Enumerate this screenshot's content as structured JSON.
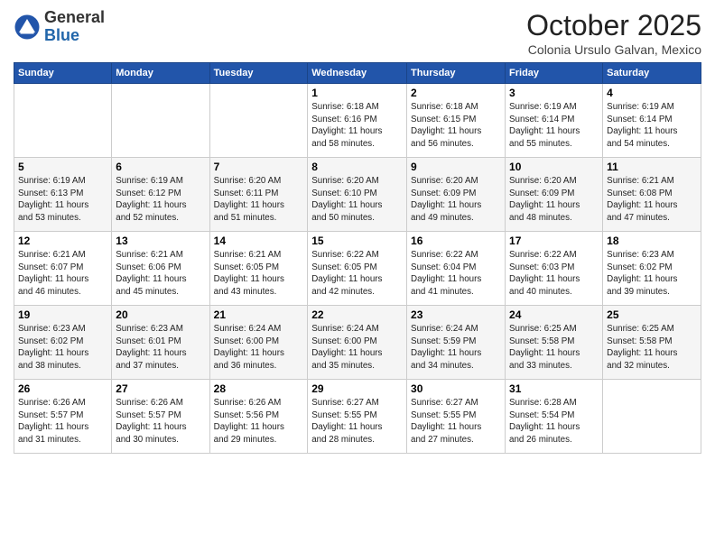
{
  "logo": {
    "general": "General",
    "blue": "Blue"
  },
  "title": "October 2025",
  "location": "Colonia Ursulo Galvan, Mexico",
  "days_of_week": [
    "Sunday",
    "Monday",
    "Tuesday",
    "Wednesday",
    "Thursday",
    "Friday",
    "Saturday"
  ],
  "weeks": [
    [
      {
        "day": "",
        "info": ""
      },
      {
        "day": "",
        "info": ""
      },
      {
        "day": "",
        "info": ""
      },
      {
        "day": "1",
        "info": "Sunrise: 6:18 AM\nSunset: 6:16 PM\nDaylight: 11 hours\nand 58 minutes."
      },
      {
        "day": "2",
        "info": "Sunrise: 6:18 AM\nSunset: 6:15 PM\nDaylight: 11 hours\nand 56 minutes."
      },
      {
        "day": "3",
        "info": "Sunrise: 6:19 AM\nSunset: 6:14 PM\nDaylight: 11 hours\nand 55 minutes."
      },
      {
        "day": "4",
        "info": "Sunrise: 6:19 AM\nSunset: 6:14 PM\nDaylight: 11 hours\nand 54 minutes."
      }
    ],
    [
      {
        "day": "5",
        "info": "Sunrise: 6:19 AM\nSunset: 6:13 PM\nDaylight: 11 hours\nand 53 minutes."
      },
      {
        "day": "6",
        "info": "Sunrise: 6:19 AM\nSunset: 6:12 PM\nDaylight: 11 hours\nand 52 minutes."
      },
      {
        "day": "7",
        "info": "Sunrise: 6:20 AM\nSunset: 6:11 PM\nDaylight: 11 hours\nand 51 minutes."
      },
      {
        "day": "8",
        "info": "Sunrise: 6:20 AM\nSunset: 6:10 PM\nDaylight: 11 hours\nand 50 minutes."
      },
      {
        "day": "9",
        "info": "Sunrise: 6:20 AM\nSunset: 6:09 PM\nDaylight: 11 hours\nand 49 minutes."
      },
      {
        "day": "10",
        "info": "Sunrise: 6:20 AM\nSunset: 6:09 PM\nDaylight: 11 hours\nand 48 minutes."
      },
      {
        "day": "11",
        "info": "Sunrise: 6:21 AM\nSunset: 6:08 PM\nDaylight: 11 hours\nand 47 minutes."
      }
    ],
    [
      {
        "day": "12",
        "info": "Sunrise: 6:21 AM\nSunset: 6:07 PM\nDaylight: 11 hours\nand 46 minutes."
      },
      {
        "day": "13",
        "info": "Sunrise: 6:21 AM\nSunset: 6:06 PM\nDaylight: 11 hours\nand 45 minutes."
      },
      {
        "day": "14",
        "info": "Sunrise: 6:21 AM\nSunset: 6:05 PM\nDaylight: 11 hours\nand 43 minutes."
      },
      {
        "day": "15",
        "info": "Sunrise: 6:22 AM\nSunset: 6:05 PM\nDaylight: 11 hours\nand 42 minutes."
      },
      {
        "day": "16",
        "info": "Sunrise: 6:22 AM\nSunset: 6:04 PM\nDaylight: 11 hours\nand 41 minutes."
      },
      {
        "day": "17",
        "info": "Sunrise: 6:22 AM\nSunset: 6:03 PM\nDaylight: 11 hours\nand 40 minutes."
      },
      {
        "day": "18",
        "info": "Sunrise: 6:23 AM\nSunset: 6:02 PM\nDaylight: 11 hours\nand 39 minutes."
      }
    ],
    [
      {
        "day": "19",
        "info": "Sunrise: 6:23 AM\nSunset: 6:02 PM\nDaylight: 11 hours\nand 38 minutes."
      },
      {
        "day": "20",
        "info": "Sunrise: 6:23 AM\nSunset: 6:01 PM\nDaylight: 11 hours\nand 37 minutes."
      },
      {
        "day": "21",
        "info": "Sunrise: 6:24 AM\nSunset: 6:00 PM\nDaylight: 11 hours\nand 36 minutes."
      },
      {
        "day": "22",
        "info": "Sunrise: 6:24 AM\nSunset: 6:00 PM\nDaylight: 11 hours\nand 35 minutes."
      },
      {
        "day": "23",
        "info": "Sunrise: 6:24 AM\nSunset: 5:59 PM\nDaylight: 11 hours\nand 34 minutes."
      },
      {
        "day": "24",
        "info": "Sunrise: 6:25 AM\nSunset: 5:58 PM\nDaylight: 11 hours\nand 33 minutes."
      },
      {
        "day": "25",
        "info": "Sunrise: 6:25 AM\nSunset: 5:58 PM\nDaylight: 11 hours\nand 32 minutes."
      }
    ],
    [
      {
        "day": "26",
        "info": "Sunrise: 6:26 AM\nSunset: 5:57 PM\nDaylight: 11 hours\nand 31 minutes."
      },
      {
        "day": "27",
        "info": "Sunrise: 6:26 AM\nSunset: 5:57 PM\nDaylight: 11 hours\nand 30 minutes."
      },
      {
        "day": "28",
        "info": "Sunrise: 6:26 AM\nSunset: 5:56 PM\nDaylight: 11 hours\nand 29 minutes."
      },
      {
        "day": "29",
        "info": "Sunrise: 6:27 AM\nSunset: 5:55 PM\nDaylight: 11 hours\nand 28 minutes."
      },
      {
        "day": "30",
        "info": "Sunrise: 6:27 AM\nSunset: 5:55 PM\nDaylight: 11 hours\nand 27 minutes."
      },
      {
        "day": "31",
        "info": "Sunrise: 6:28 AM\nSunset: 5:54 PM\nDaylight: 11 hours\nand 26 minutes."
      },
      {
        "day": "",
        "info": ""
      }
    ]
  ]
}
